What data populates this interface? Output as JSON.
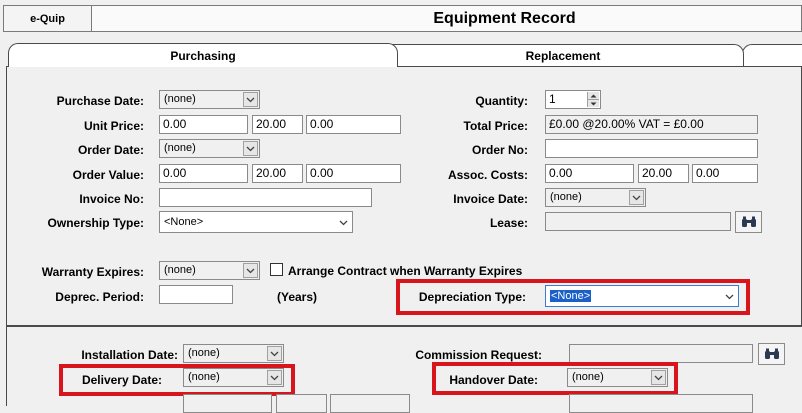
{
  "header": {
    "app_tab": "e-Quip",
    "title": "Equipment Record"
  },
  "tabs": {
    "purchasing": "Purchasing",
    "replacement": "Replacement"
  },
  "purchasing": {
    "purchase_date": {
      "label": "Purchase Date:",
      "value": "(none)"
    },
    "quantity": {
      "label": "Quantity:",
      "value": "1"
    },
    "unit_price": {
      "label": "Unit Price:",
      "net": "0.00",
      "vat_rate": "20.00",
      "vat": "0.00"
    },
    "total_price": {
      "label": "Total Price:",
      "value": "£0.00 @20.00% VAT = £0.00"
    },
    "order_date": {
      "label": "Order Date:",
      "value": "(none)"
    },
    "order_no": {
      "label": "Order No:",
      "value": ""
    },
    "order_value": {
      "label": "Order Value:",
      "net": "0.00",
      "vat_rate": "20.00",
      "vat": "0.00"
    },
    "assoc_costs": {
      "label": "Assoc. Costs:",
      "net": "0.00",
      "vat_rate": "20.00",
      "vat": "0.00"
    },
    "invoice_no": {
      "label": "Invoice No:",
      "value": ""
    },
    "invoice_date": {
      "label": "Invoice Date:",
      "value": "(none)"
    },
    "ownership_type": {
      "label": "Ownership Type:",
      "value": "<None>"
    },
    "lease": {
      "label": "Lease:",
      "value": ""
    },
    "warranty_expires": {
      "label": "Warranty Expires:",
      "value": "(none)"
    },
    "arrange_contract": {
      "label": "Arrange Contract when Warranty Expires",
      "checked": false
    },
    "deprec_period": {
      "label": "Deprec. Period:",
      "value": "",
      "unit": "(Years)"
    },
    "depreciation_type": {
      "label": "Depreciation Type:",
      "value": "<None>"
    }
  },
  "lower": {
    "installation_date": {
      "label": "Installation Date:",
      "value": "(none)"
    },
    "commission_request": {
      "label": "Commission Request:",
      "value": ""
    },
    "delivery_date": {
      "label": "Delivery Date:",
      "value": "(none)"
    },
    "handover_date": {
      "label": "Handover Date:",
      "value": "(none)"
    }
  },
  "icons": {
    "dropdown": "chevron-down-icon",
    "search": "binoculars-icon"
  },
  "colors": {
    "highlight": "#d8141c",
    "selection": "#1b5fc9"
  }
}
